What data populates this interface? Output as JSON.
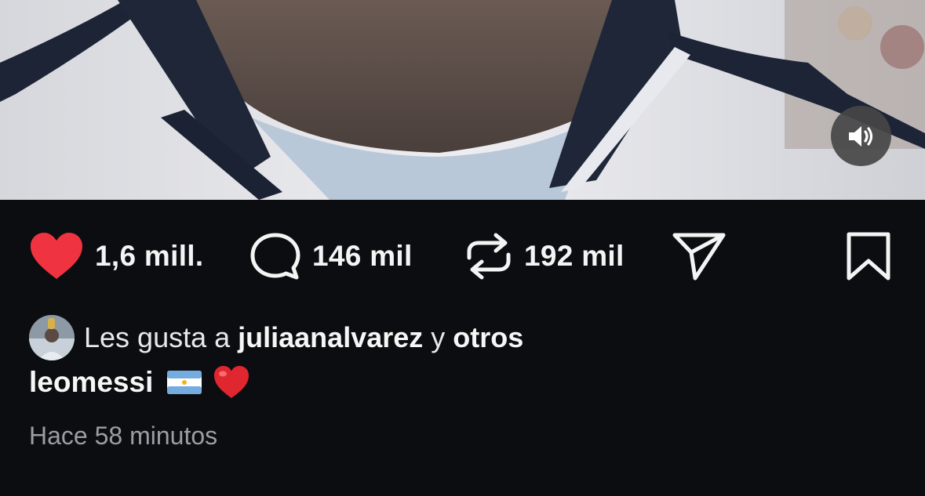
{
  "media": {
    "audio_icon": "speaker-icon"
  },
  "actions": {
    "like": {
      "icon": "heart-icon",
      "count": "1,6 mill.",
      "color": "#ef3340"
    },
    "comment": {
      "icon": "comment-bubble-icon",
      "count": "146 mil"
    },
    "repost": {
      "icon": "repost-icon",
      "count": "192 mil"
    },
    "share": {
      "icon": "paper-plane-icon"
    },
    "save": {
      "icon": "bookmark-icon"
    }
  },
  "liked_by": {
    "prefix": "Les gusta a ",
    "user": "juliaanalvarez",
    "connector": " y ",
    "others": "otros"
  },
  "caption": {
    "username": "leomessi",
    "emojis": [
      "argentina-flag",
      "red-heart"
    ]
  },
  "timestamp": "Hace 58 minutos"
}
